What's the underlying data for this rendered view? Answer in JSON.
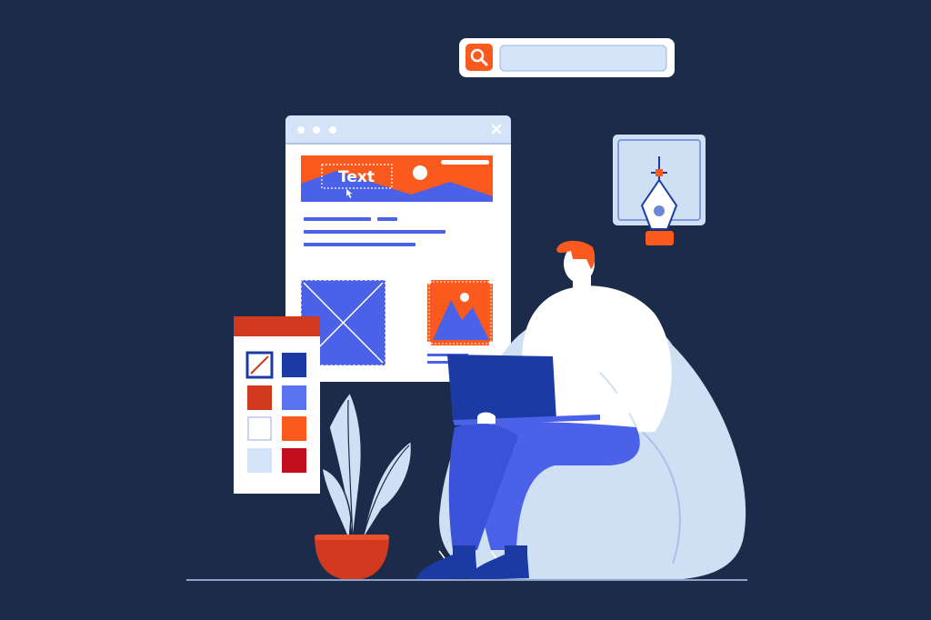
{
  "illustration": {
    "banner_text": "Text",
    "icons": [
      "search-icon",
      "pen-tool-icon",
      "close-icon",
      "image-placeholder-icon",
      "cursor-icon"
    ],
    "colors": {
      "background": "#1c2b49",
      "accent_orange": "#fb5a1e",
      "accent_blue": "#4a61e8",
      "light_blue": "#cfe0f5",
      "dark_blue": "#1b3aa3",
      "red": "#d13a1f",
      "white": "#ffffff"
    }
  }
}
